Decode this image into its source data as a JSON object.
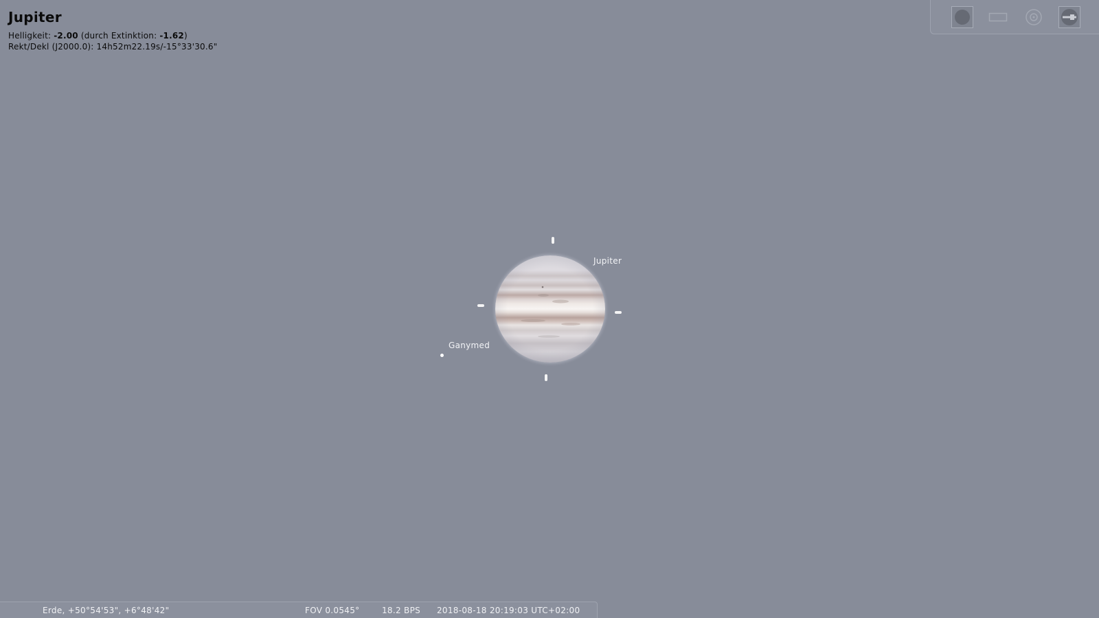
{
  "object_info": {
    "title": "Jupiter",
    "magnitude_prefix": "Helligkeit: ",
    "magnitude_value": "-2.00",
    "extinction_prefix": " (durch Extinktion: ",
    "extinction_value": "-1.62",
    "extinction_suffix": ")",
    "radec": "Rekt/Dekl (J2000.0): 14h52m22.19s/-15°33'30.6\""
  },
  "toolbar": {
    "buttons": [
      {
        "name": "planet-view-icon"
      },
      {
        "name": "ocular-icon"
      },
      {
        "name": "crosshair-icon"
      },
      {
        "name": "telescope-icon"
      }
    ]
  },
  "sky": {
    "labels": {
      "jupiter": "Jupiter",
      "ganymede": "Ganymed"
    }
  },
  "status_bar": {
    "location": "Erde, +50°54'53\", +6°48'42\"",
    "fov": "FOV 0.0545°",
    "fps": "18.2 BPS",
    "datetime": "2018-08-18 20:19:03 UTC+02:00"
  },
  "colors": {
    "sky_background": "#878c99",
    "info_text": "#0b0b0b",
    "label_text": "#f2f3f6"
  }
}
